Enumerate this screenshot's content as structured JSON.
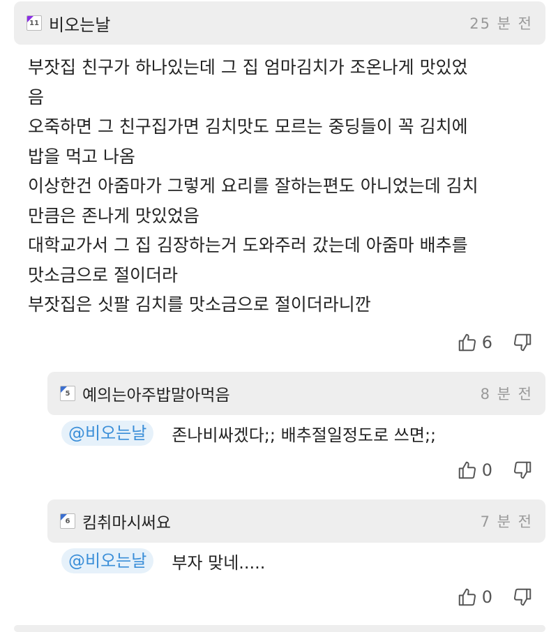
{
  "main_comment": {
    "level": "11",
    "nickname": "비오는날",
    "time": "25 분 전",
    "lines": [
      "부잣집 친구가 하나있는데 그 집 엄마김치가 조온나게 맛있었",
      "음",
      "오죽하면 그 친구집가면 김치맛도 모르는 중딩들이 꼭 김치에",
      "밥을 먹고 나옴",
      "이상한건 아줌마가 그렇게 요리를 잘하는편도 아니었는데 김치",
      "만큼은 존나게 맛있었음",
      "대학교가서 그 집 김장하는거 도와주러 갔는데 아줌마 배추를",
      "맛소금으로 절이더라",
      "부잣집은 싯팔 김치를 맛소금으로 절이더라니깐"
    ],
    "likes": "6"
  },
  "replies": [
    {
      "level": "5",
      "nickname": "예의는아주밥말아먹음",
      "time": "8 분 전",
      "mention": "@비오는날",
      "text": "존나비싸겠다;; 배추절일정도로 쓰면;;",
      "likes": "0"
    },
    {
      "level": "6",
      "nickname": "킴취마시써요",
      "time": "7 분 전",
      "mention": "@비오는날",
      "text": "부자 맞네.....",
      "likes": "0"
    }
  ],
  "icons": {
    "like": "thumbs-up-icon",
    "dislike": "thumbs-down-icon"
  },
  "colors": {
    "header_bg": "#eeeeee",
    "mention_bg": "#e6f1fa",
    "mention_text": "#3a8ed8"
  }
}
